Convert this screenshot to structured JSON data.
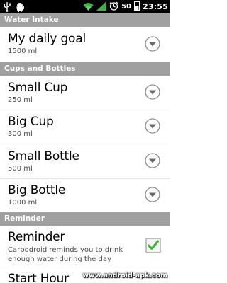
{
  "status_bar": {
    "battery_percent": "50",
    "time": "23:55"
  },
  "sections": {
    "water_intake": "Water Intake",
    "cups_and_bottles": "Cups and Bottles",
    "reminder": "Reminder"
  },
  "daily_goal": {
    "title": "My daily goal",
    "value": "1500 ml"
  },
  "cups": [
    {
      "title": "Small Cup",
      "value": "250 ml"
    },
    {
      "title": "Big Cup",
      "value": "300 ml"
    },
    {
      "title": "Small Bottle",
      "value": "500 ml"
    },
    {
      "title": "Big Bottle",
      "value": "1000 ml"
    }
  ],
  "reminder": {
    "title": "Reminder",
    "summary": "Carbodroid reminds you to drink enough water during the day",
    "checked": true
  },
  "start_hour": {
    "title": "Start Hour"
  },
  "watermark": "www.android-apk.com",
  "colors": {
    "section_header_bg": "#a0a0a0",
    "checkbox_green": "#37b42a",
    "status_bar_bg": "#000000"
  },
  "icons": {
    "usb": "usb-icon",
    "android": "android-icon",
    "wifi": "wifi-icon",
    "signal": "signal-icon",
    "alarm": "alarm-icon",
    "battery": "battery-icon",
    "chevron": "chevron-down-circle-icon",
    "checkbox": "checkbox-checked-icon"
  }
}
